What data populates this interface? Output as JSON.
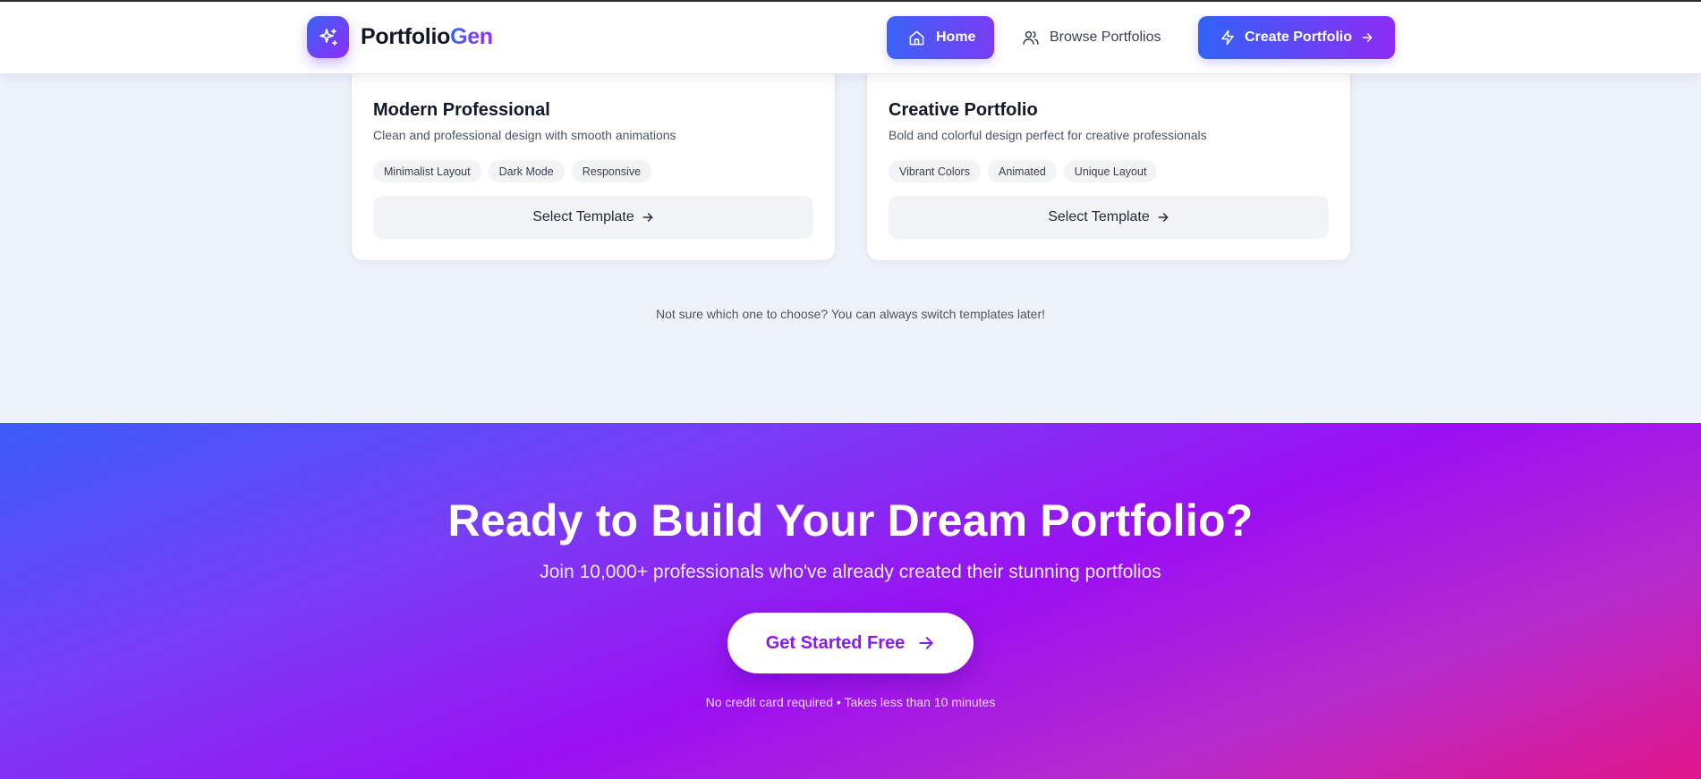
{
  "brand": {
    "name_part1": "Portfolio",
    "name_part2": "Gen",
    "logo_icon": "sparkles-icon"
  },
  "nav": {
    "home_label": "Home",
    "browse_label": "Browse Portfolios",
    "create_label": "Create Portfolio"
  },
  "templates": [
    {
      "title": "Modern Professional",
      "description": "Clean and professional design with smooth animations",
      "tags": [
        "Minimalist Layout",
        "Dark Mode",
        "Responsive"
      ],
      "button_label": "Select Template"
    },
    {
      "title": "Creative Portfolio",
      "description": "Bold and colorful design perfect for creative professionals",
      "tags": [
        "Vibrant Colors",
        "Animated",
        "Unique Layout"
      ],
      "button_label": "Select Template"
    }
  ],
  "hint_text": "Not sure which one to choose? You can always switch templates later!",
  "cta": {
    "title": "Ready to Build Your Dream Portfolio?",
    "subtitle": "Join 10,000+ professionals who've already created their stunning portfolios",
    "button_label": "Get Started Free",
    "note": "No credit card required • Takes less than 10 minutes"
  },
  "colors": {
    "accent_blue": "#3b63f6",
    "accent_purple": "#9b10f2",
    "accent_pink": "#e0168a",
    "page_background": "#eef2fb"
  }
}
